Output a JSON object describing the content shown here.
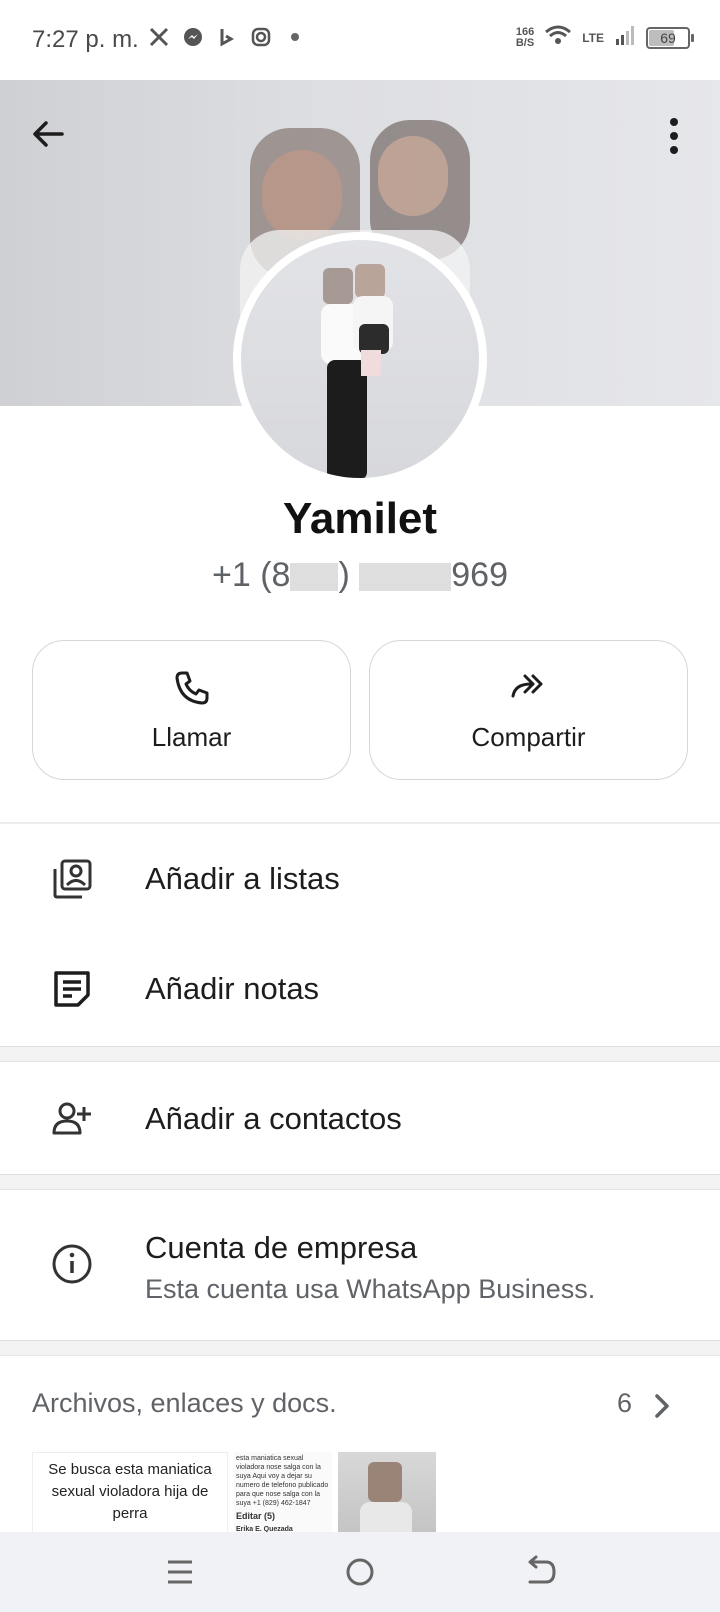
{
  "status_bar": {
    "time": "7:27 p. m.",
    "speed_value": "166",
    "speed_unit": "B/S",
    "network": "LTE",
    "battery": "69"
  },
  "contact": {
    "name": "Yamilet",
    "phone_prefix": "+1 (8",
    "phone_suffix": "969"
  },
  "actions": [
    {
      "label": "Llamar",
      "icon": "phone-icon"
    },
    {
      "label": "Compartir",
      "icon": "share-icon"
    }
  ],
  "menu": {
    "add_to_lists": "Añadir a listas",
    "add_notes": "Añadir notas",
    "add_to_contacts": "Añadir a contactos",
    "business_title": "Cuenta de empresa",
    "business_subtitle": "Esta cuenta usa WhatsApp Business."
  },
  "files": {
    "title": "Archivos, enlaces y docs.",
    "count": "6",
    "thumb1_text": "Se busca esta maniatica sexual violadora hija de perra",
    "thumb2_text": "esta maniatica sexual violadora nose salga con la suya Aqui voy a dejar su numero de telefono publicado para que nose salga con la suya +1 (829) 462-1847",
    "thumb2_button": "Editar (5)",
    "thumb2_name": "Erika E. Quezada (Accountant and Real Estate Agent)"
  },
  "colors": {
    "accent_text": "#1d1d1d",
    "secondary_text": "#606367",
    "cover_bg": "#dcdde1"
  }
}
